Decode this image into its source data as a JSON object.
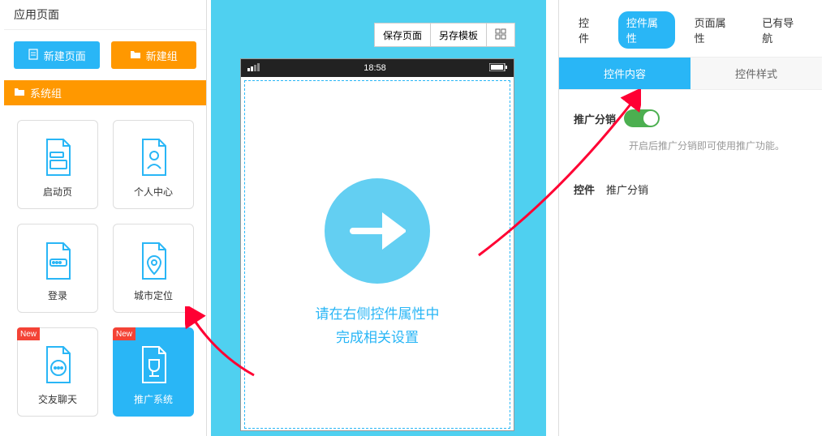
{
  "left": {
    "title": "应用页面",
    "new_page": "新建页面",
    "new_group": "新建组",
    "group_header": "系统组",
    "tiles": [
      {
        "label": "启动页",
        "new": false
      },
      {
        "label": "个人中心",
        "new": false
      },
      {
        "label": "登录",
        "new": false
      },
      {
        "label": "城市定位",
        "new": false
      },
      {
        "label": "交友聊天",
        "new": true
      },
      {
        "label": "推广系统",
        "new": true
      }
    ],
    "badge": "New"
  },
  "toolbar": {
    "save_page": "保存页面",
    "save_template": "另存模板",
    "layout_icon": "⊞"
  },
  "phone": {
    "time": "18:58",
    "signal": "▮▮▯",
    "battery": "▮▮▮▮",
    "canvas_line1": "请在右侧控件属性中",
    "canvas_line2": "完成相关设置"
  },
  "right": {
    "tabs": [
      "控件",
      "控件属性",
      "页面属性",
      "已有导航"
    ],
    "subtabs": [
      "控件内容",
      "控件样式"
    ],
    "toggle_label": "推广分销",
    "hint": "开启后推广分销即可使用推广功能。",
    "ctrl_key": "控件",
    "ctrl_val": "推广分销"
  }
}
